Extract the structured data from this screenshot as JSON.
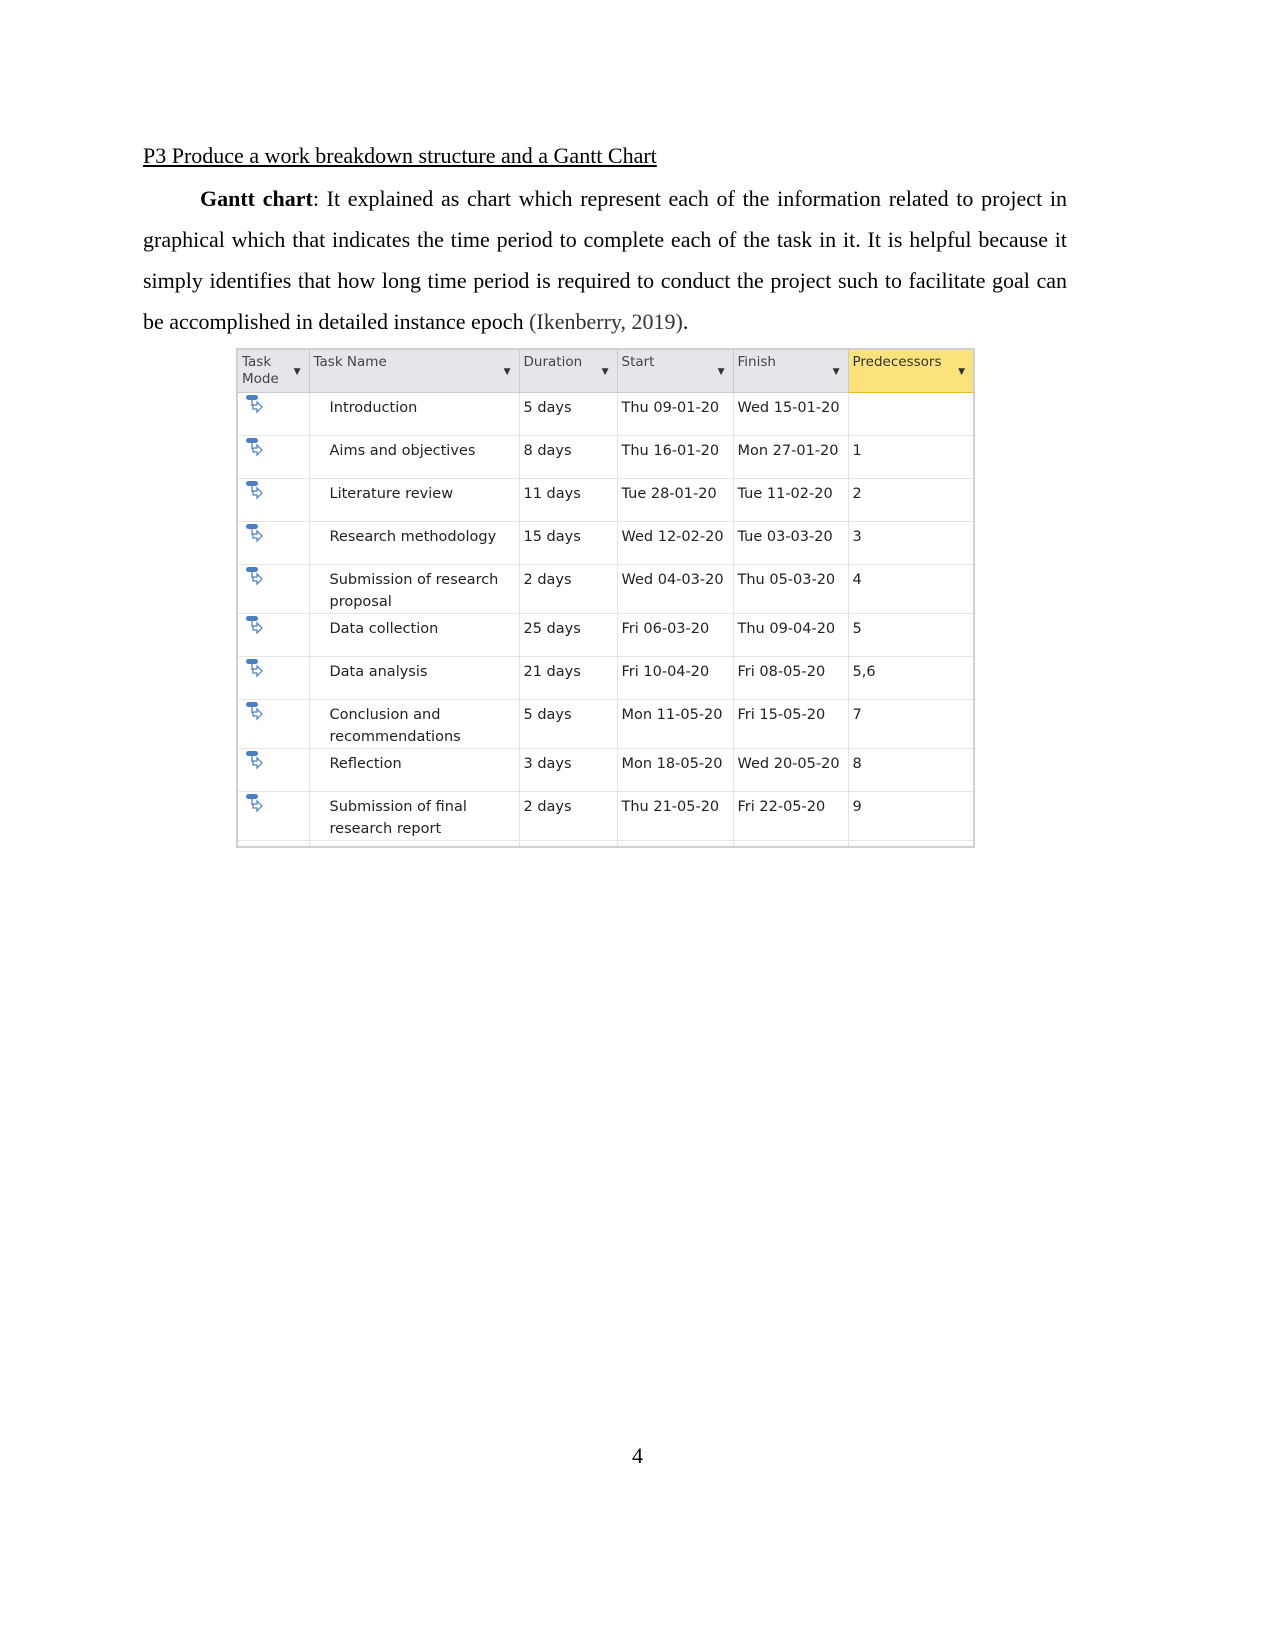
{
  "heading": "P3 Produce a work breakdown structure and a Gantt Chart",
  "paragraph": {
    "lead": "Gantt chart",
    "body": ":  It explained as chart which represent each of the information related to project in graphical which that indicates the time period to complete each of the task in it. It is helpful because it simply identifies that how long time period is required to conduct the project such to facilitate goal can be accomplished in detailed instance epoch ",
    "citation": "(Ikenberry, 2019)",
    "end": "."
  },
  "table": {
    "columns": [
      "Task Mode",
      "Task Name",
      "Duration",
      "Start",
      "Finish",
      "Predecessors"
    ],
    "highlight_column": "Predecessors",
    "highlight_color": "#fbe27a",
    "task_mode_icon": "auto-scheduled-task-icon",
    "rows": [
      {
        "name": "Introduction",
        "duration": "5 days",
        "start": "Thu 09-01-20",
        "finish": "Wed 15-01-20",
        "pred": ""
      },
      {
        "name": "Aims and objectives",
        "duration": "8 days",
        "start": "Thu 16-01-20",
        "finish": "Mon 27-01-20",
        "pred": "1"
      },
      {
        "name": "Literature review",
        "duration": "11 days",
        "start": "Tue 28-01-20",
        "finish": "Tue 11-02-20",
        "pred": "2"
      },
      {
        "name": "Research methodology",
        "duration": "15 days",
        "start": "Wed 12-02-20",
        "finish": "Tue 03-03-20",
        "pred": "3"
      },
      {
        "name": "Submission of research proposal",
        "duration": "2 days",
        "start": "Wed 04-03-20",
        "finish": "Thu 05-03-20",
        "pred": "4"
      },
      {
        "name": "Data collection",
        "duration": "25 days",
        "start": "Fri 06-03-20",
        "finish": "Thu 09-04-20",
        "pred": "5"
      },
      {
        "name": "Data analysis",
        "duration": "21 days",
        "start": "Fri 10-04-20",
        "finish": "Fri 08-05-20",
        "pred": "5,6"
      },
      {
        "name": "Conclusion and recommendations",
        "duration": "5 days",
        "start": "Mon 11-05-20",
        "finish": "Fri 15-05-20",
        "pred": "7"
      },
      {
        "name": "Reflection",
        "duration": "3 days",
        "start": "Mon 18-05-20",
        "finish": "Wed 20-05-20",
        "pred": "8"
      },
      {
        "name": "Submission of final research report",
        "duration": "2 days",
        "start": "Thu 21-05-20",
        "finish": "Fri 22-05-20",
        "pred": "9"
      }
    ]
  },
  "page_number": "4"
}
